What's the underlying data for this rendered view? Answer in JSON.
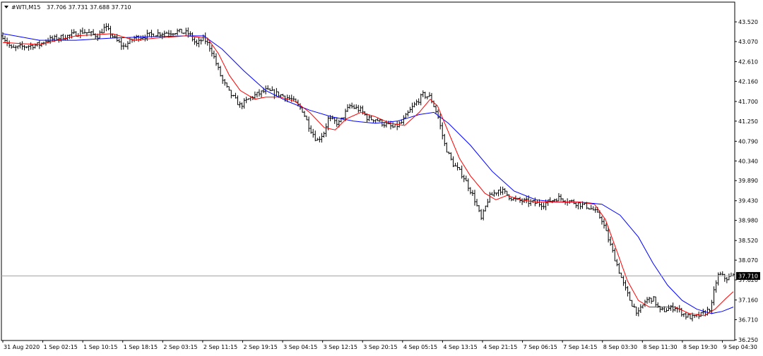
{
  "header": {
    "symbol": "#WTI,M15",
    "ohlc": "37.706 37.731 37.688 37.710"
  },
  "colors": {
    "background": "#ffffff",
    "frame": "#000000",
    "bars": "#000000",
    "fast_ma": "#ff0000",
    "slow_ma": "#0000ff",
    "bid_line": "#a0a0a0",
    "price_tag_bg": "#000000",
    "price_tag_text": "#ffffff"
  },
  "chart_data": {
    "type": "ohlc",
    "instrument": "#WTI",
    "timeframe": "M15",
    "last_price": 37.71,
    "ylim": [
      36.25,
      43.75
    ],
    "y_ticks": [
      "43.520",
      "43.070",
      "42.610",
      "42.160",
      "41.700",
      "41.250",
      "40.790",
      "40.340",
      "39.890",
      "39.430",
      "38.980",
      "38.520",
      "38.070",
      "37.620",
      "37.160",
      "36.710",
      "36.250"
    ],
    "x_ticks": [
      "31 Aug 2020",
      "1 Sep 02:15",
      "1 Sep 10:15",
      "1 Sep 18:15",
      "2 Sep 03:15",
      "2 Sep 11:15",
      "2 Sep 19:15",
      "3 Sep 04:15",
      "3 Sep 12:15",
      "3 Sep 20:15",
      "4 Sep 05:15",
      "4 Sep 13:15",
      "4 Sep 21:15",
      "7 Sep 06:15",
      "7 Sep 14:15",
      "8 Sep 03:30",
      "8 Sep 11:30",
      "8 Sep 19:30",
      "9 Sep 04:30"
    ],
    "price_path": [
      [
        0,
        43.2
      ],
      [
        0.012,
        42.9
      ],
      [
        0.025,
        42.95
      ],
      [
        0.05,
        43.0
      ],
      [
        0.06,
        43.1
      ],
      [
        0.09,
        43.2
      ],
      [
        0.11,
        43.3
      ],
      [
        0.13,
        43.2
      ],
      [
        0.14,
        43.4
      ],
      [
        0.155,
        43.1
      ],
      [
        0.165,
        42.95
      ],
      [
        0.18,
        43.15
      ],
      [
        0.21,
        43.25
      ],
      [
        0.24,
        43.3
      ],
      [
        0.255,
        43.25
      ],
      [
        0.265,
        43.0
      ],
      [
        0.275,
        43.15
      ],
      [
        0.285,
        42.9
      ],
      [
        0.3,
        42.2
      ],
      [
        0.31,
        41.9
      ],
      [
        0.325,
        41.6
      ],
      [
        0.34,
        41.8
      ],
      [
        0.36,
        41.95
      ],
      [
        0.38,
        41.85
      ],
      [
        0.395,
        41.75
      ],
      [
        0.41,
        41.5
      ],
      [
        0.42,
        41.1
      ],
      [
        0.43,
        40.8
      ],
      [
        0.44,
        41.0
      ],
      [
        0.445,
        41.3
      ],
      [
        0.46,
        41.2
      ],
      [
        0.475,
        41.6
      ],
      [
        0.49,
        41.5
      ],
      [
        0.5,
        41.3
      ],
      [
        0.51,
        41.3
      ],
      [
        0.52,
        41.2
      ],
      [
        0.535,
        41.1
      ],
      [
        0.545,
        41.2
      ],
      [
        0.56,
        41.55
      ],
      [
        0.575,
        41.85
      ],
      [
        0.585,
        41.8
      ],
      [
        0.595,
        41.4
      ],
      [
        0.605,
        40.7
      ],
      [
        0.615,
        40.3
      ],
      [
        0.63,
        40.0
      ],
      [
        0.645,
        39.5
      ],
      [
        0.655,
        39.0
      ],
      [
        0.665,
        39.5
      ],
      [
        0.68,
        39.7
      ],
      [
        0.7,
        39.45
      ],
      [
        0.72,
        39.4
      ],
      [
        0.74,
        39.35
      ],
      [
        0.76,
        39.5
      ],
      [
        0.78,
        39.4
      ],
      [
        0.8,
        39.3
      ],
      [
        0.81,
        39.2
      ],
      [
        0.82,
        39.0
      ],
      [
        0.83,
        38.5
      ],
      [
        0.84,
        38.0
      ],
      [
        0.85,
        37.5
      ],
      [
        0.86,
        37.1
      ],
      [
        0.87,
        36.85
      ],
      [
        0.88,
        37.15
      ],
      [
        0.89,
        37.2
      ],
      [
        0.9,
        36.9
      ],
      [
        0.91,
        36.95
      ],
      [
        0.92,
        37.0
      ],
      [
        0.935,
        36.8
      ],
      [
        0.945,
        36.75
      ],
      [
        0.96,
        36.85
      ],
      [
        0.97,
        37.0
      ],
      [
        0.975,
        37.5
      ],
      [
        0.98,
        37.75
      ],
      [
        0.99,
        37.65
      ],
      [
        1.0,
        37.71
      ]
    ],
    "series": [
      {
        "kind": "fast_ma",
        "points": [
          [
            0,
            43.05
          ],
          [
            0.05,
            43.0
          ],
          [
            0.1,
            43.2
          ],
          [
            0.15,
            43.25
          ],
          [
            0.18,
            43.1
          ],
          [
            0.21,
            43.15
          ],
          [
            0.25,
            43.2
          ],
          [
            0.28,
            43.15
          ],
          [
            0.295,
            42.8
          ],
          [
            0.31,
            42.3
          ],
          [
            0.325,
            41.95
          ],
          [
            0.345,
            41.75
          ],
          [
            0.36,
            41.8
          ],
          [
            0.38,
            41.8
          ],
          [
            0.4,
            41.7
          ],
          [
            0.42,
            41.45
          ],
          [
            0.44,
            41.1
          ],
          [
            0.455,
            41.05
          ],
          [
            0.47,
            41.3
          ],
          [
            0.49,
            41.45
          ],
          [
            0.51,
            41.35
          ],
          [
            0.53,
            41.2
          ],
          [
            0.55,
            41.15
          ],
          [
            0.57,
            41.45
          ],
          [
            0.585,
            41.75
          ],
          [
            0.595,
            41.6
          ],
          [
            0.61,
            41.0
          ],
          [
            0.625,
            40.4
          ],
          [
            0.64,
            40.0
          ],
          [
            0.66,
            39.6
          ],
          [
            0.675,
            39.45
          ],
          [
            0.69,
            39.55
          ],
          [
            0.71,
            39.45
          ],
          [
            0.73,
            39.4
          ],
          [
            0.76,
            39.4
          ],
          [
            0.79,
            39.4
          ],
          [
            0.81,
            39.35
          ],
          [
            0.825,
            39.0
          ],
          [
            0.84,
            38.3
          ],
          [
            0.855,
            37.6
          ],
          [
            0.87,
            37.15
          ],
          [
            0.885,
            37.0
          ],
          [
            0.9,
            37.0
          ],
          [
            0.92,
            37.0
          ],
          [
            0.94,
            36.85
          ],
          [
            0.96,
            36.8
          ],
          [
            0.975,
            36.95
          ],
          [
            0.99,
            37.2
          ],
          [
            1.0,
            37.35
          ]
        ]
      },
      {
        "kind": "slow_ma",
        "points": [
          [
            0,
            43.25
          ],
          [
            0.05,
            43.1
          ],
          [
            0.1,
            43.1
          ],
          [
            0.15,
            43.15
          ],
          [
            0.2,
            43.18
          ],
          [
            0.25,
            43.2
          ],
          [
            0.275,
            43.2
          ],
          [
            0.3,
            42.9
          ],
          [
            0.33,
            42.4
          ],
          [
            0.36,
            41.95
          ],
          [
            0.39,
            41.7
          ],
          [
            0.42,
            41.5
          ],
          [
            0.45,
            41.35
          ],
          [
            0.48,
            41.25
          ],
          [
            0.51,
            41.2
          ],
          [
            0.54,
            41.25
          ],
          [
            0.57,
            41.4
          ],
          [
            0.59,
            41.45
          ],
          [
            0.61,
            41.2
          ],
          [
            0.64,
            40.7
          ],
          [
            0.67,
            40.1
          ],
          [
            0.7,
            39.65
          ],
          [
            0.73,
            39.45
          ],
          [
            0.76,
            39.4
          ],
          [
            0.79,
            39.4
          ],
          [
            0.82,
            39.35
          ],
          [
            0.845,
            39.1
          ],
          [
            0.87,
            38.6
          ],
          [
            0.89,
            38.0
          ],
          [
            0.91,
            37.5
          ],
          [
            0.93,
            37.15
          ],
          [
            0.95,
            36.95
          ],
          [
            0.97,
            36.85
          ],
          [
            0.985,
            36.9
          ],
          [
            1.0,
            37.0
          ]
        ]
      }
    ],
    "grid": false,
    "legend": "none"
  }
}
